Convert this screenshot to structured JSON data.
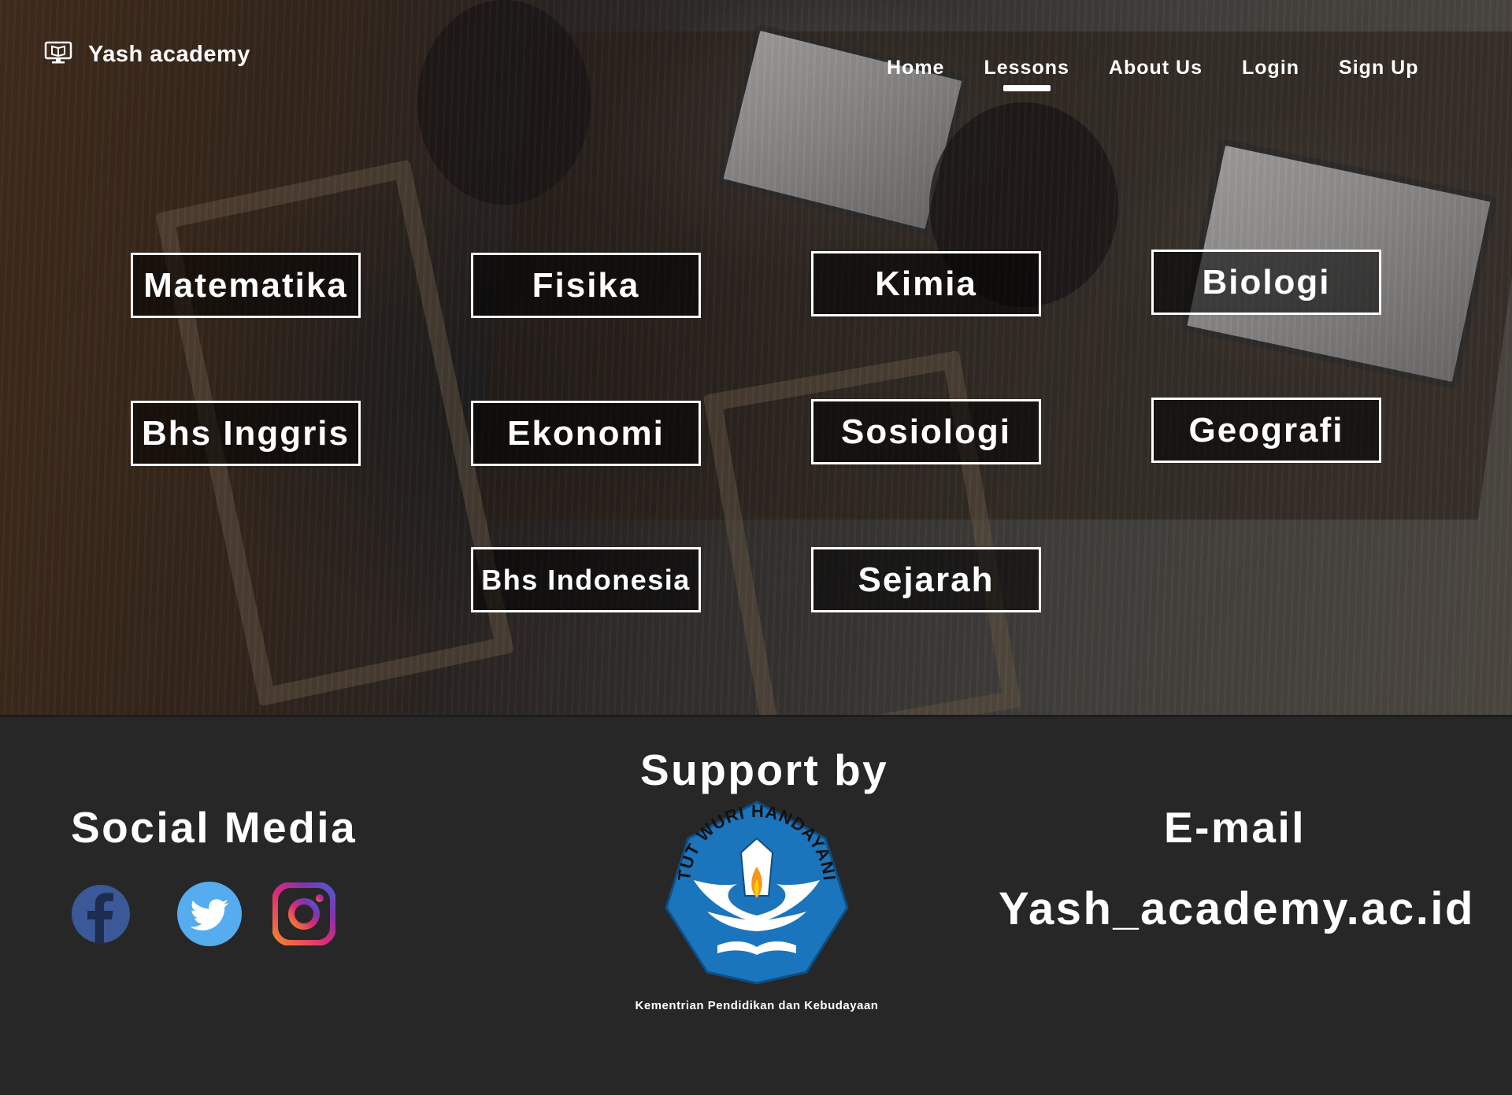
{
  "brand": {
    "name": "Yash academy",
    "icon": "laptop-book-icon"
  },
  "nav": {
    "items": [
      {
        "label": "Home",
        "active": false
      },
      {
        "label": "Lessons",
        "active": true
      },
      {
        "label": "About Us",
        "active": false
      },
      {
        "label": "Login",
        "active": false
      },
      {
        "label": "Sign Up",
        "active": false
      }
    ]
  },
  "lessons": [
    "Matematika",
    "Fisika",
    "Kimia",
    "Biologi",
    "Bhs Inggris",
    "Ekonomi",
    "Sosiologi",
    "Geografi",
    "Bhs Indonesia",
    "Sejarah"
  ],
  "footer": {
    "social": {
      "title": "Social Media",
      "links": [
        {
          "name": "Facebook",
          "icon": "facebook-icon",
          "color": "#3b5998"
        },
        {
          "name": "Twitter",
          "icon": "twitter-icon",
          "color": "#55acee"
        },
        {
          "name": "Instagram",
          "icon": "instagram-icon",
          "color": "#c13584"
        }
      ]
    },
    "support": {
      "title": "Support by",
      "logo_text": "TUT WURI HANDAYANI",
      "caption": "Kementrian Pendidikan dan Kebudayaan",
      "logo_color": "#1b75bc"
    },
    "email": {
      "title": "E-mail",
      "address": "Yash_academy.ac.id"
    }
  },
  "colors": {
    "footer_bg": "#272727",
    "text": "#ffffff"
  }
}
